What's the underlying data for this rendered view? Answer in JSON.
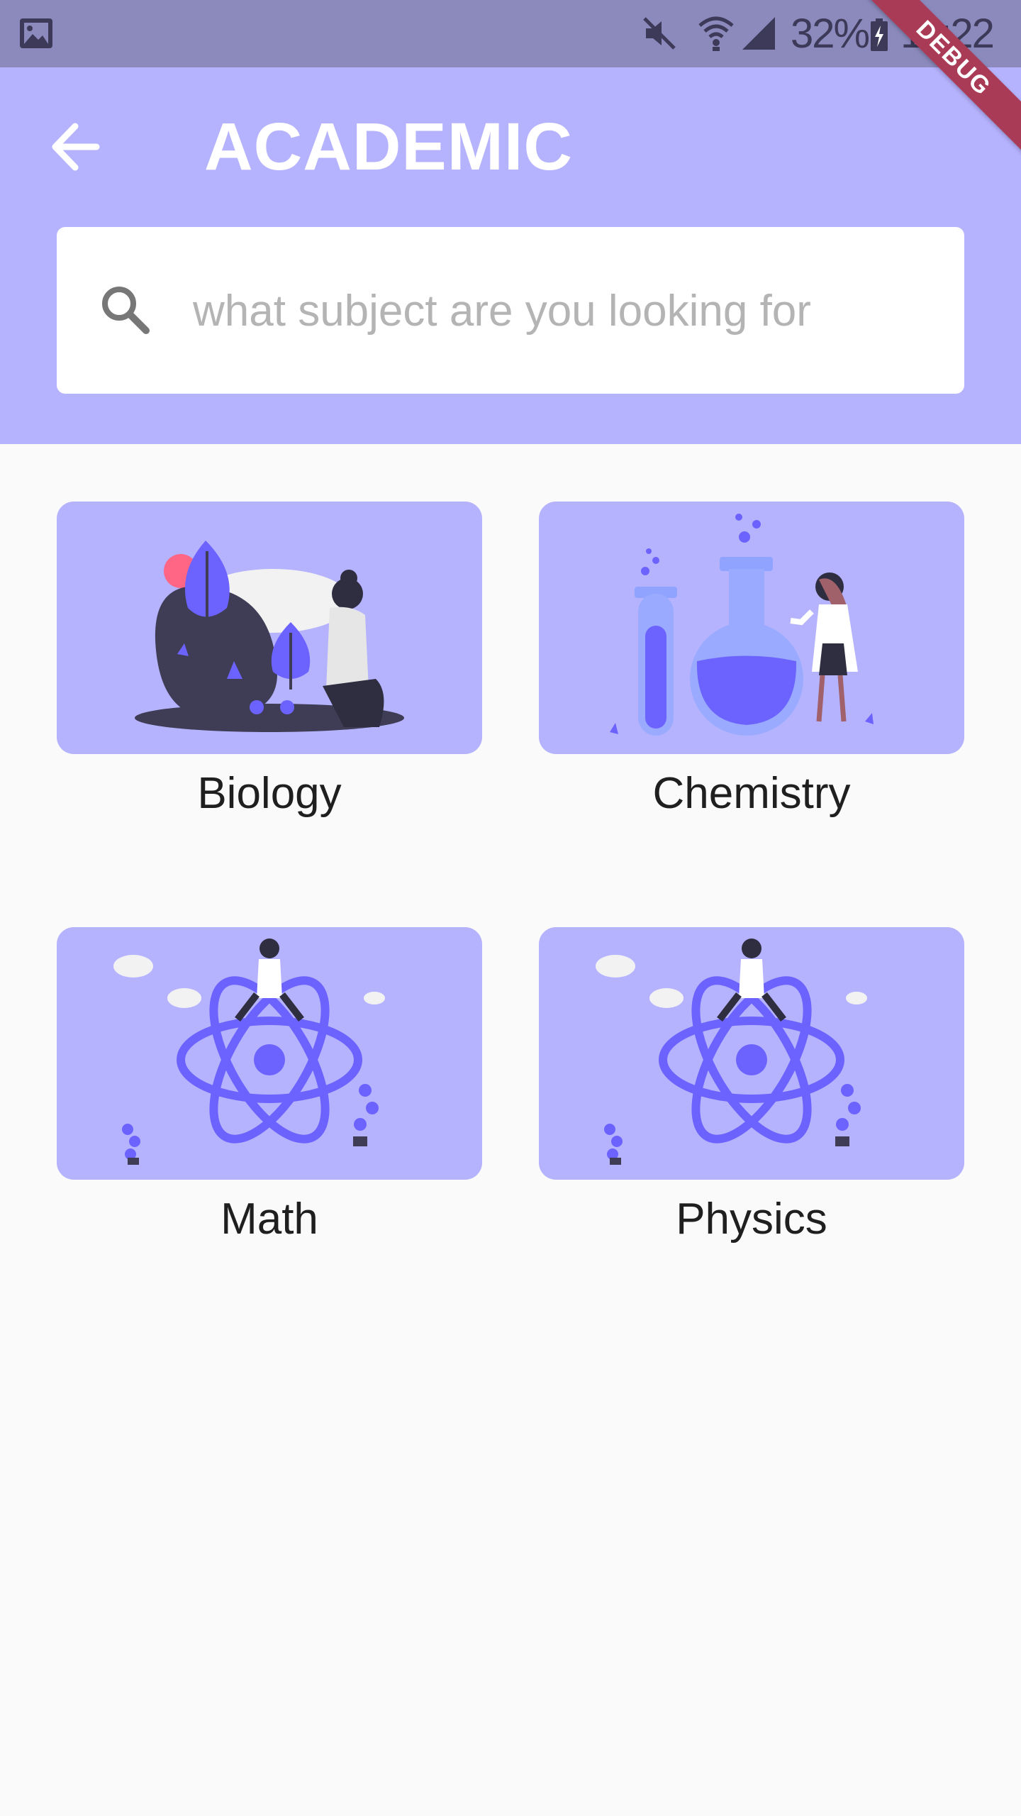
{
  "status_bar": {
    "battery_percent": "32%",
    "time": "11:22",
    "icons": [
      "gallery-icon",
      "mute-icon",
      "wifi-icon",
      "signal-icon",
      "battery-charging-icon"
    ]
  },
  "debug_banner": "DEBUG",
  "app_bar": {
    "title": "ACADEMIC",
    "back_icon": "arrow-left-icon"
  },
  "search": {
    "placeholder": "what subject are you looking for",
    "value": "",
    "icon": "search-icon"
  },
  "subjects": [
    {
      "label": "Biology",
      "illustration": "biology-illustration"
    },
    {
      "label": "Chemistry",
      "illustration": "chemistry-illustration"
    },
    {
      "label": "Math",
      "illustration": "atom-illustration"
    },
    {
      "label": "Physics",
      "illustration": "atom-illustration"
    }
  ],
  "colors": {
    "header": "#b6b3fe",
    "accent": "#6c63ff",
    "status_bar": "#8c89bd",
    "background": "#fafafa"
  }
}
